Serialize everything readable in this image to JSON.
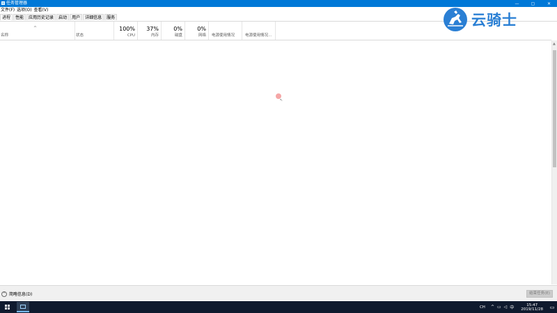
{
  "window": {
    "title": "任务管理器",
    "controls": [
      "—",
      "▢",
      "✕"
    ]
  },
  "menu": [
    "文件(F)",
    "选项(O)",
    "查看(V)"
  ],
  "tabs": [
    "进程",
    "性能",
    "应用历史记录",
    "启动",
    "用户",
    "详细信息",
    "服务"
  ],
  "columns": {
    "name": "名称",
    "status": "状态",
    "cpu": {
      "pct": "100%",
      "label": "CPU"
    },
    "memory": {
      "pct": "37%",
      "label": "内存"
    },
    "disk": {
      "pct": "0%",
      "label": "磁盘"
    },
    "network": {
      "pct": "0%",
      "label": "网络"
    },
    "power": "电源使用情况",
    "power_trend": "电源使用情况..."
  },
  "footer": {
    "fewer_details": "简略信息(D)",
    "end_task": "结束任务(E)"
  },
  "taskbar": {
    "ime": "CH",
    "time": "15:47",
    "date": "2019/11/28"
  },
  "watermark": {
    "text": "云骑士"
  },
  "colors": {
    "titlebar": "#0078d7",
    "taskbar": "#0f1a2e",
    "watermark": "#2a7fd4"
  }
}
